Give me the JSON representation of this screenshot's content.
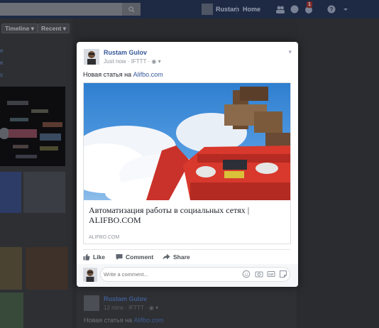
{
  "topbar": {
    "user_name": "Rustam",
    "home_label": "Home",
    "notification_count": "1"
  },
  "timeline": {
    "timeline_label": "Timeline",
    "recent_label": "Recent"
  },
  "post": {
    "author": "Rustam Gulov",
    "time": "Just now",
    "via": "IFTTT",
    "text_prefix": "Новая статья на",
    "text_link": "Alifbo.com",
    "link_card": {
      "title": "Автоматизация работы в социальных сетях | ALIFBO.COM",
      "domain": "ALIFBO.COM"
    },
    "actions": {
      "like": "Like",
      "comment": "Comment",
      "share": "Share"
    },
    "comment_placeholder": "Write a comment..."
  },
  "background_post": {
    "author": "Rustam Gulov",
    "time": "12 mins",
    "via": "IFTTT",
    "text_prefix": "Новая статья на",
    "text_link": "Alifbo.com"
  },
  "colors": {
    "brand": "#365899",
    "topbar": "#1e2a44"
  }
}
